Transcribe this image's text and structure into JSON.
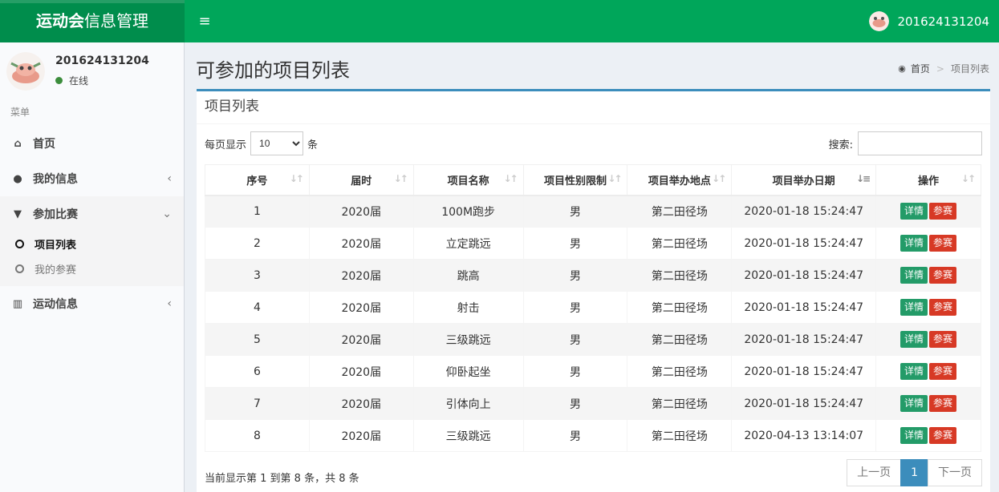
{
  "app": {
    "title_bold": "运动会",
    "title_rest": "信息管理",
    "toggle": "≡"
  },
  "user": {
    "name": "201624131204",
    "status": "在线"
  },
  "sidebar": {
    "header": "菜单",
    "items": [
      {
        "label": "首页",
        "icon": "home-icon",
        "glyph": "⌂"
      },
      {
        "label": "我的信息",
        "icon": "user-icon",
        "glyph": "●",
        "arrow": "‹"
      },
      {
        "label": "参加比赛",
        "icon": "trophy-icon",
        "glyph": "▼",
        "arrow": "⌄",
        "sub": [
          {
            "label": "项目列表"
          },
          {
            "label": "我的参赛"
          }
        ]
      },
      {
        "label": "运动信息",
        "icon": "bar-chart-icon",
        "glyph": "▥",
        "arrow": "‹"
      }
    ]
  },
  "page": {
    "title": "可参加的项目列表",
    "breadcrumb": [
      "首页",
      "项目列表"
    ],
    "breadcrumb_sep": ">"
  },
  "box": {
    "title": "项目列表"
  },
  "controls": {
    "show_prefix": "每页显示",
    "page_size": "10",
    "show_suffix": "条",
    "search_label": "搜索:"
  },
  "table": {
    "headers": [
      "序号",
      "届时",
      "项目名称",
      "项目性别限制",
      "项目举办地点",
      "项目举办日期",
      "操作"
    ],
    "detail_label": "详情",
    "join_label": "参赛",
    "rows": [
      [
        "1",
        "2020届",
        "100M跑步",
        "男",
        "第二田径场",
        "2020-01-18 15:24:47"
      ],
      [
        "2",
        "2020届",
        "立定跳远",
        "男",
        "第二田径场",
        "2020-01-18 15:24:47"
      ],
      [
        "3",
        "2020届",
        "跳高",
        "男",
        "第二田径场",
        "2020-01-18 15:24:47"
      ],
      [
        "4",
        "2020届",
        "射击",
        "男",
        "第二田径场",
        "2020-01-18 15:24:47"
      ],
      [
        "5",
        "2020届",
        "三级跳远",
        "男",
        "第二田径场",
        "2020-01-18 15:24:47"
      ],
      [
        "6",
        "2020届",
        "仰卧起坐",
        "男",
        "第二田径场",
        "2020-01-18 15:24:47"
      ],
      [
        "7",
        "2020届",
        "引体向上",
        "男",
        "第二田径场",
        "2020-01-18 15:24:47"
      ],
      [
        "8",
        "2020届",
        "三级跳远",
        "男",
        "第二田径场",
        "2020-04-13 13:14:07"
      ]
    ]
  },
  "footer": {
    "info": "当前显示第 1 到第 8 条，共 8 条"
  },
  "pagination": {
    "prev": "上一页",
    "current": "1",
    "next": "下一页"
  },
  "colors": {
    "topbar": "#00a65a",
    "logo_bg": "#008d4c",
    "box_border": "#3c8dbc",
    "detail_btn": "#239b68",
    "join_btn": "#d73925"
  }
}
